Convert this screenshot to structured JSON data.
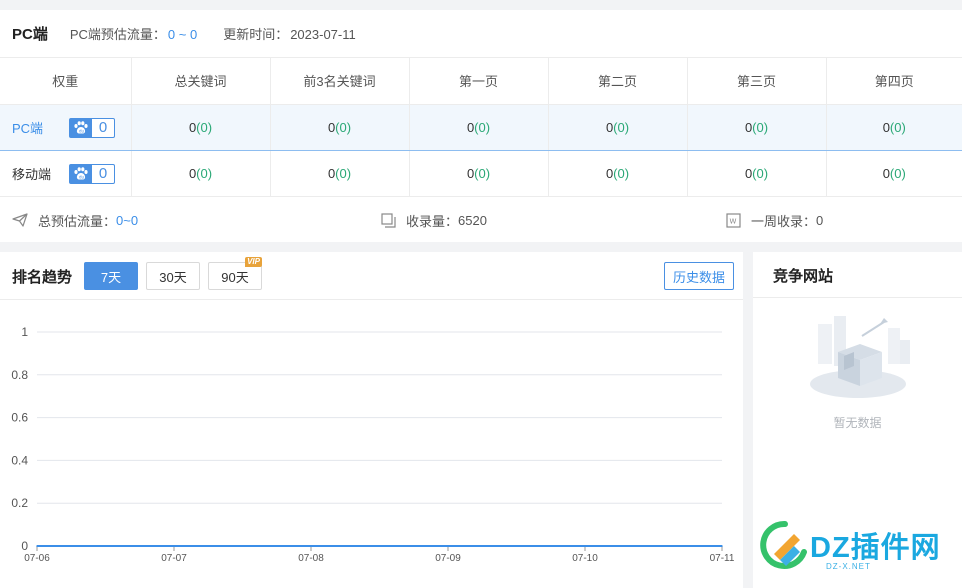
{
  "pc_section": {
    "title": "PC端",
    "traffic_label": "PC端预估流量：",
    "traffic_value": "0 ~ 0",
    "update_label": "更新时间：",
    "update_value": "2023-07-11"
  },
  "rank_table": {
    "columns": [
      "权重",
      "总关键词",
      "前3名关键词",
      "第一页",
      "第二页",
      "第三页",
      "第四页"
    ],
    "rows": [
      {
        "label": "PC端",
        "weight": "0",
        "cells": [
          {
            "value": "0",
            "change": "(0)"
          },
          {
            "value": "0",
            "change": "(0)"
          },
          {
            "value": "0",
            "change": "(0)"
          },
          {
            "value": "0",
            "change": "(0)"
          },
          {
            "value": "0",
            "change": "(0)"
          },
          {
            "value": "0",
            "change": "(0)"
          }
        ]
      },
      {
        "label": "移动端",
        "weight": "0",
        "cells": [
          {
            "value": "0",
            "change": "(0)"
          },
          {
            "value": "0",
            "change": "(0)"
          },
          {
            "value": "0",
            "change": "(0)"
          },
          {
            "value": "0",
            "change": "(0)"
          },
          {
            "value": "0",
            "change": "(0)"
          },
          {
            "value": "0",
            "change": "(0)"
          }
        ]
      }
    ]
  },
  "summary": {
    "total_traffic_label": "总预估流量：",
    "total_traffic_value": "0~0",
    "indexed_label": "收录量：",
    "indexed_value": "6520",
    "weekly_label": "一周收录：",
    "weekly_value": "0"
  },
  "trend": {
    "title": "排名趋势",
    "range_buttons": [
      "7天",
      "30天",
      "90天"
    ],
    "active_range": "7天",
    "vip_badge": "VIP",
    "history_button": "历史数据"
  },
  "competitor": {
    "title": "竞争网站",
    "empty_text": "暂无数据"
  },
  "watermark": {
    "brand": "DZ插件网",
    "domain": "DZ-X.NET"
  },
  "colors": {
    "accent": "#4a90e2",
    "positive": "#2aa876",
    "line": "#3b8ee8"
  },
  "chart_data": {
    "type": "line",
    "x": [
      "07-06",
      "07-07",
      "07-08",
      "07-09",
      "07-10",
      "07-11"
    ],
    "series": [
      {
        "values": [
          0,
          0,
          0,
          0,
          0,
          0
        ]
      }
    ],
    "yticks": [
      0,
      0.2,
      0.4,
      0.6,
      0.8,
      1
    ],
    "ylim": [
      0,
      1
    ],
    "grid": true
  }
}
